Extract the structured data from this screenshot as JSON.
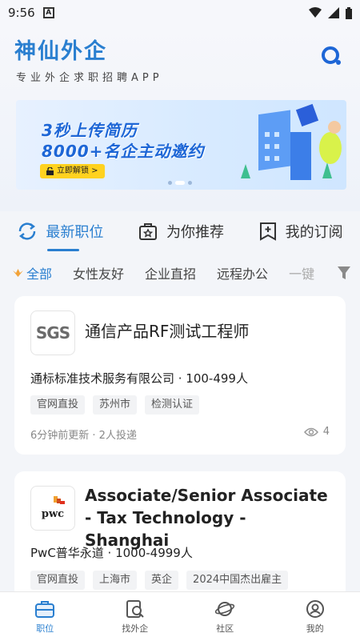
{
  "status_bar": {
    "time": "9:56",
    "notif_icon_letter": "A"
  },
  "header": {
    "brand": "神仙外企",
    "slogan": "专业外企求职招聘APP"
  },
  "banner": {
    "line1": "3秒上传简历",
    "line2": "8000+名企主动邀约",
    "button": "立即解锁 >"
  },
  "tabs": [
    {
      "label": "最新职位",
      "icon": "refresh-icon",
      "active": true
    },
    {
      "label": "为你推荐",
      "icon": "star-box-icon",
      "active": false
    },
    {
      "label": "我的订阅",
      "icon": "subscribe-icon",
      "active": false
    }
  ],
  "filters": [
    "全部",
    "女性友好",
    "企业直招",
    "远程办公",
    "一键"
  ],
  "jobs": [
    {
      "logo": "SGS",
      "title": "通信产品RF测试工程师",
      "company": "通标标准技术服务有限公司 · 100-499人",
      "tags": [
        "官网直投",
        "苏州市",
        "检测认证"
      ],
      "meta": "6分钟前更新 · 2人投递",
      "views": "4"
    },
    {
      "logo": "pwc",
      "title": "Associate/Senior Associate - Tax Technology - Shanghai",
      "company": "PwC普华永道 · 1000-4999人",
      "tags": [
        "官网直投",
        "上海市",
        "英企",
        "2024中国杰出雇主"
      ]
    }
  ],
  "bottom_nav": [
    {
      "label": "职位",
      "icon": "briefcase-icon",
      "active": true
    },
    {
      "label": "找外企",
      "icon": "search-company-icon",
      "active": false
    },
    {
      "label": "社区",
      "icon": "planet-icon",
      "active": false
    },
    {
      "label": "我的",
      "icon": "profile-icon",
      "active": false
    }
  ],
  "colors": {
    "accent": "#2a7fd0",
    "banner_text": "#1d66d6",
    "button_yellow": "#ffd21f"
  }
}
